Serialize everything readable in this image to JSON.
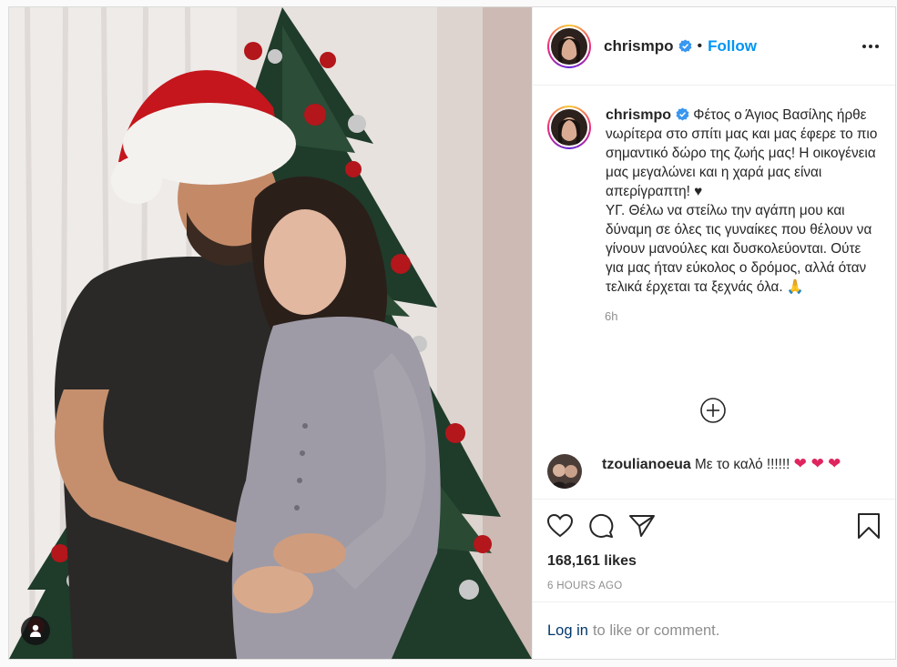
{
  "post": {
    "username": "chrismpo",
    "follow_label": "Follow",
    "separator": "•",
    "caption": {
      "username": "chrismpo",
      "text": "Φέτος ο Άγιος Βασίλης ήρθε νωρίτερα στο σπίτι μας και μας έφερε το πιο σημαντικό δώρο της ζωής μας! Η οικογένεια μας μεγαλώνει και η χαρά μας είναι απερίγραπτη! ♥\nΥΓ. Θέλω να στείλω την αγάπη μου και δύναμη σε όλες τις γυναίκες που θέλουν να γίνουν μανούλες και δυσκολεύονται. Ούτε για μας ήταν εύκολος ο δρόμος, αλλά όταν τελικά έρχεται τα ξεχνάς όλα. 🙏",
      "time_ago": "6h"
    },
    "comment": {
      "username": "tzoulianoeua",
      "text": "Με το καλό !!!!!!",
      "hearts": "❤ ❤",
      "heart_trailing": "❤"
    },
    "likes_text": "168,161 likes",
    "date_text": "6 HOURS AGO",
    "login": {
      "link": "Log in",
      "rest": "to like or comment."
    }
  },
  "icons": {
    "verified": "verified-badge-icon",
    "more": "more-options-icon",
    "load_more": "plus-circle-icon",
    "like": "heart-outline-icon",
    "comment": "comment-bubble-icon",
    "share": "paper-plane-icon",
    "save": "bookmark-icon",
    "tags": "user-tag-icon"
  },
  "colors": {
    "link_blue": "#0095f6",
    "verified_blue": "#3897f0",
    "heart_red": "#e0245e",
    "muted": "#8e8e8e"
  }
}
